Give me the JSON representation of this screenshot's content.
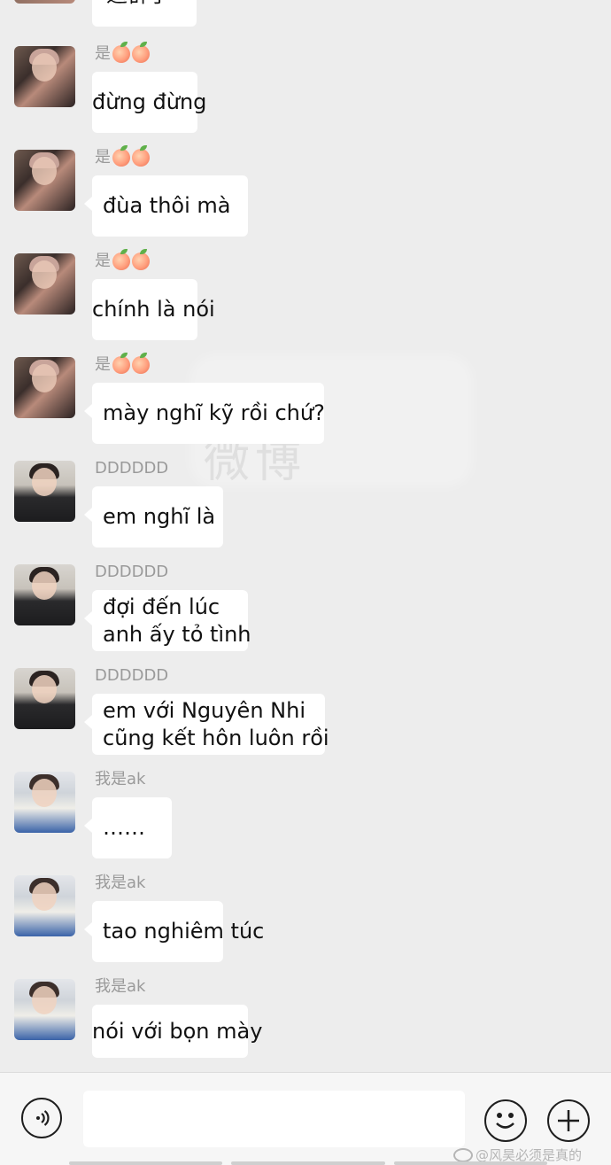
{
  "top_partial": {
    "text": "退群了"
  },
  "messages": [
    {
      "sender": "是",
      "sender_suffix": "peach-peach",
      "avatar": "peach",
      "lines": [
        "đừng đừng"
      ],
      "tail": false
    },
    {
      "sender": "是",
      "sender_suffix": "peach-peach",
      "avatar": "peach",
      "lines": [
        "đùa thôi mà"
      ],
      "tail": true
    },
    {
      "sender": "是",
      "sender_suffix": "peach-peach",
      "avatar": "peach",
      "lines": [
        "chính là nói"
      ],
      "tail": false
    },
    {
      "sender": "是",
      "sender_suffix": "peach-peach",
      "avatar": "peach",
      "lines": [
        "mày nghĩ kỹ rồi chứ?"
      ],
      "tail": true
    },
    {
      "sender": "DDDDDD",
      "avatar": "dddddd",
      "lines": [
        "em nghĩ là"
      ],
      "tail": true
    },
    {
      "sender": "DDDDDD",
      "avatar": "dddddd",
      "lines": [
        "đợi đến lúc",
        "anh ấy tỏ tình"
      ],
      "tail": true
    },
    {
      "sender": "DDDDDD",
      "avatar": "dddddd",
      "lines": [
        "em với Nguyên Nhi",
        "cũng kết hôn luôn rồi"
      ],
      "tail": true
    },
    {
      "sender": "我是ak",
      "avatar": "ak",
      "lines": [
        "……"
      ],
      "tail": true
    },
    {
      "sender": "我是ak",
      "avatar": "ak",
      "lines": [
        "tao nghiêm túc"
      ],
      "tail": true
    },
    {
      "sender": "我是ak",
      "avatar": "ak",
      "lines": [
        "nói với bọn mày"
      ],
      "tail": false
    }
  ],
  "watermark": "微博",
  "input_bar": {
    "voice_icon": "voice-icon",
    "emoji_icon": "smiley-icon",
    "plus_icon": "plus-icon",
    "input_value": ""
  },
  "credit": "@风昊必须是真的"
}
